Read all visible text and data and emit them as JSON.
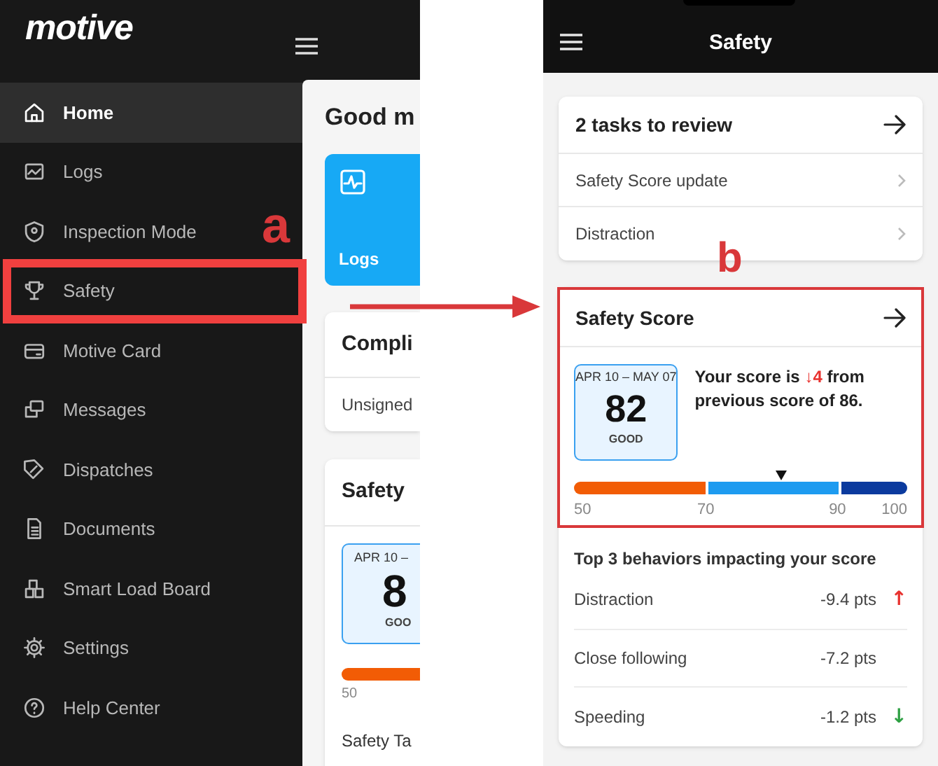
{
  "left_screen": {
    "logo": "motive",
    "sidebar": {
      "items": [
        {
          "label": "Home",
          "selected": true,
          "annotated": false
        },
        {
          "label": "Logs",
          "selected": false,
          "annotated": false
        },
        {
          "label": "Inspection Mode",
          "selected": false,
          "annotated": false
        },
        {
          "label": "Safety",
          "selected": false,
          "annotated": true
        },
        {
          "label": "Motive Card",
          "selected": false,
          "annotated": false
        },
        {
          "label": "Messages",
          "selected": false,
          "annotated": false
        },
        {
          "label": "Dispatches",
          "selected": false,
          "annotated": false
        },
        {
          "label": "Documents",
          "selected": false,
          "annotated": false
        },
        {
          "label": "Smart Load Board",
          "selected": false,
          "annotated": false
        },
        {
          "label": "Settings",
          "selected": false,
          "annotated": false
        },
        {
          "label": "Help Center",
          "selected": false,
          "annotated": false
        }
      ]
    },
    "annotation": "a",
    "home": {
      "greeting": "Good m",
      "logs_tile": "Logs",
      "compliance_card": {
        "title": "Compli",
        "row": "Unsigned"
      },
      "safety_card": {
        "title": "Safety",
        "date_range": "APR 10 –",
        "score": "8",
        "rating": "GOO",
        "scale_min": "50",
        "task_label": "Safety Ta"
      }
    }
  },
  "right_screen": {
    "title": "Safety",
    "tasks_card": {
      "title": "2 tasks to review",
      "rows": [
        "Safety Score update",
        "Distraction"
      ]
    },
    "annotation": "b",
    "safety_score_card": {
      "title": "Safety Score",
      "date_range": "APR 10 – MAY 07",
      "score": "82",
      "rating": "GOOD",
      "summary": {
        "prefix": "Your score is",
        "change": "↓4",
        "suffix": "from previous score of 86."
      },
      "marker": {
        "level": 0.62
      },
      "segments": [
        {
          "color": "#f25c05"
        },
        {
          "color": "#1d9bf0"
        },
        {
          "color": "#0b3a9e"
        }
      ],
      "scale_labels": [
        "50",
        "70",
        "90",
        "100"
      ]
    },
    "behaviors": {
      "title": "Top 3 behaviors impacting your score",
      "rows": [
        {
          "label": "Distraction",
          "value": "-9.4 pts",
          "trend": "↑",
          "color": "#e8322f"
        },
        {
          "label": "Close following",
          "value": "-7.2 pts"
        },
        {
          "label": "Speeding",
          "value": "-1.2 pts",
          "trend": "↓",
          "color": "#2ea043"
        }
      ]
    }
  }
}
